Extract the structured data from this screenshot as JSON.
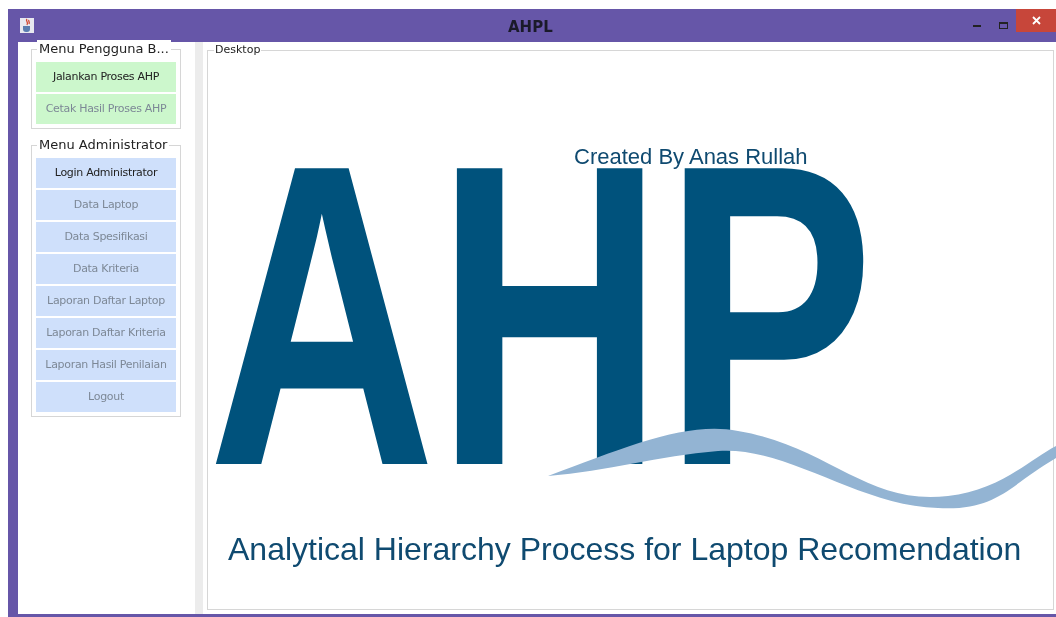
{
  "window": {
    "title": "AHPL"
  },
  "menu_groups": [
    {
      "title": "Menu Pengguna B...",
      "kind": "user",
      "buttons": [
        {
          "label": "Jalankan Proses AHP",
          "disabled": false
        },
        {
          "label": "Cetak Hasil Proses AHP",
          "disabled": true
        }
      ]
    },
    {
      "title": "Menu Administrator",
      "kind": "admin",
      "buttons": [
        {
          "label": "Login Administrator",
          "disabled": false
        },
        {
          "label": "Data Laptop",
          "disabled": true
        },
        {
          "label": "Data Spesifikasi",
          "disabled": true
        },
        {
          "label": "Data Kriteria",
          "disabled": true
        },
        {
          "label": "Laporan Daftar Laptop",
          "disabled": true
        },
        {
          "label": "Laporan Daftar Kriteria",
          "disabled": true
        },
        {
          "label": "Laporan Hasil Penilaian",
          "disabled": true
        },
        {
          "label": "Logout",
          "disabled": true
        }
      ]
    }
  ],
  "desktop": {
    "title": "Desktop",
    "logo_text": "AHP",
    "credit": "Created By Anas Rullah",
    "subtitle": "Analytical Hierarchy Process for Laptop Recomendation"
  }
}
